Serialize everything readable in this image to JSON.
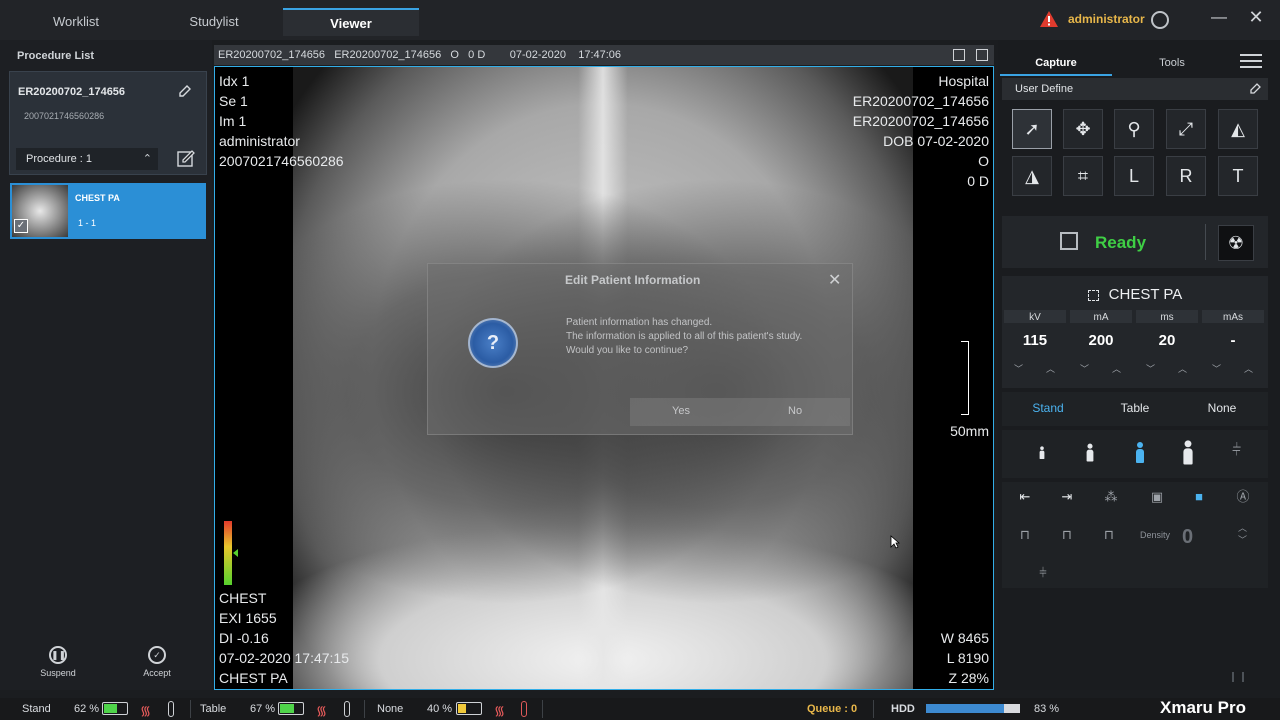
{
  "tabs": [
    {
      "label": "Worklist"
    },
    {
      "label": "Studylist"
    },
    {
      "label": "Viewer"
    }
  ],
  "user": {
    "name": "administrator"
  },
  "window": {
    "minimize": "—",
    "close": "✕"
  },
  "left": {
    "title": "Procedure List",
    "card_id": "ER20200702_174656",
    "card_sub": "2007021746560286",
    "procedure_label": "Procedure :  1",
    "study_name": "CHEST PA",
    "study_seq": "1 - 1",
    "suspend": "Suspend",
    "accept": "Accept"
  },
  "viewer": {
    "header": "ER20200702_174656   ER20200702_174656   O   0 D        07-02-2020    17:47:06",
    "tl": [
      "Idx 1",
      "Se 1",
      "Im 1",
      "administrator",
      "2007021746560286"
    ],
    "tr": [
      "Hospital",
      "ER20200702_174656",
      "ER20200702_174656",
      "DOB 07-02-2020",
      "O",
      "0 D"
    ],
    "scale": "50mm",
    "bl": [
      "CHEST",
      "EXI 1655",
      "DI -0.16",
      "07-02-2020 17:47:15",
      "CHEST PA"
    ],
    "br": [
      "W 8465",
      "L 8190",
      "Z 28%"
    ]
  },
  "dialog": {
    "title": "Edit Patient Information",
    "icon": "?",
    "lines": [
      "Patient information has changed.",
      "The information is applied to all of this patient's study.",
      "Would you like to continue?"
    ],
    "yes": "Yes",
    "no": "No"
  },
  "right": {
    "tab_capture": "Capture",
    "tab_tools": "Tools",
    "user_define": "User Define",
    "ready": "Ready",
    "exam": "CHEST PA",
    "params": [
      {
        "label": "kV",
        "value": "115"
      },
      {
        "label": "mA",
        "value": "200"
      },
      {
        "label": "ms",
        "value": "20"
      },
      {
        "label": "mAs",
        "value": "-"
      }
    ],
    "positions": [
      "Stand",
      "Table",
      "None"
    ],
    "density_label": "Density",
    "density_value": "0"
  },
  "status": {
    "stand": "Stand",
    "stand_pct": "62 %",
    "table": "Table",
    "table_pct": "67 %",
    "none": "None",
    "none_pct": "40 %",
    "stand_level": 0.62,
    "table_level": 0.67,
    "none_level": 0.4,
    "queue": "Queue :  0",
    "hdd": "HDD",
    "hdd_pct": "83 %",
    "hdd_level": 0.83,
    "brand": "Xmaru Pro"
  },
  "colors": {
    "accent": "#3aa3e3",
    "ready": "#3fcf45",
    "warning": "#e8b74a",
    "battery_low": "#f0c93a",
    "battery_ok": "#4fd44a"
  }
}
